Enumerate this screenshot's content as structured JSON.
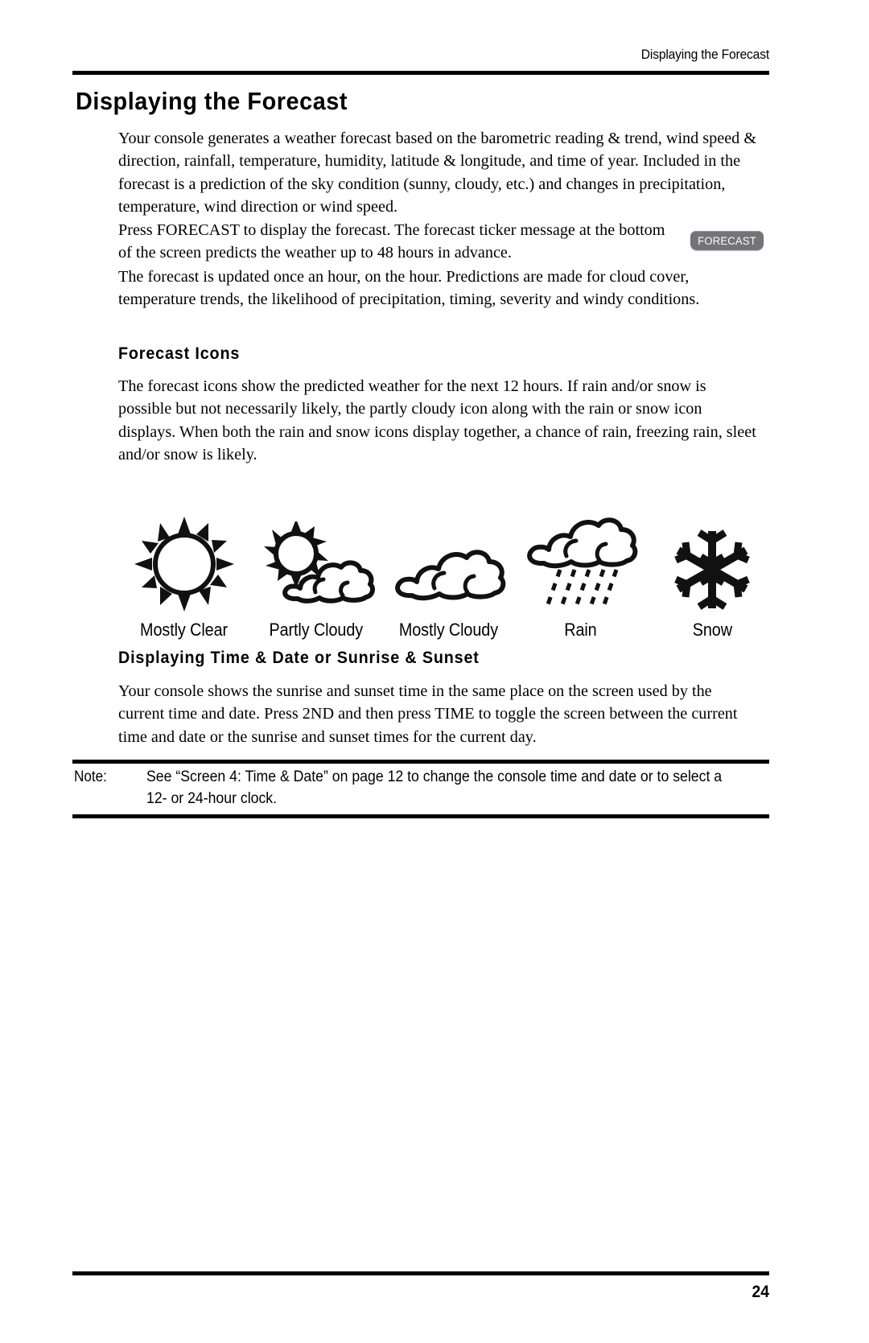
{
  "header": {
    "running_title": "Displaying the Forecast"
  },
  "page_title": "Displaying the Forecast",
  "paragraphs": {
    "intro": "Your console generates a weather forecast based on the barometric reading & trend, wind speed & direction, rainfall, temperature, humidity, latitude & longitude, and time of year. Included in the forecast is a prediction of the sky condition (sunny, cloudy, etc.) and changes in precipitation, temperature, wind direction or wind speed.",
    "press_forecast": "Press FORECAST to display the forecast. The forecast ticker message at the bottom of the screen predicts the weather up to 48 hours in advance.",
    "updated": "The forecast is updated once an hour, on the hour. Predictions are made for cloud cover, temperature trends, the likelihood of precipitation, timing, severity and windy conditions.",
    "forecast_icons": "The forecast icons show the predicted weather for the next 12 hours. If rain and/or snow is possible but not necessarily likely, the partly cloudy icon along with the rain or snow icon displays. When both the rain and snow icons display together, a chance of rain, freezing rain, sleet and/or snow is likely.",
    "time_date": "Your console shows the sunrise and sunset time in the same place on the screen used by the current time and date. Press 2ND and then press TIME to toggle the screen between the current time and date or the sunrise and sunset times for the current day."
  },
  "headings": {
    "forecast_icons": "Forecast Icons",
    "time_date": "Displaying Time & Date or Sunrise & Sunset"
  },
  "forecast_key": {
    "label": "FORECAST",
    "button_color": "#737378",
    "text_color": "#ffffff"
  },
  "forecast_icons": [
    {
      "icon": "sun-icon",
      "label": "Mostly Clear"
    },
    {
      "icon": "sun-behind-cloud-icon",
      "label": "Partly Cloudy"
    },
    {
      "icon": "cloud-icon",
      "label": "Mostly Cloudy"
    },
    {
      "icon": "cloud-rain-icon",
      "label": "Rain"
    },
    {
      "icon": "snowflake-icon",
      "label": "Snow"
    }
  ],
  "note": {
    "label": "Note:",
    "text": "See “Screen 4: Time & Date” on page 12 to change the console time and date or to select a 12- or 24-hour clock."
  },
  "footer": {
    "page_number": "24"
  }
}
